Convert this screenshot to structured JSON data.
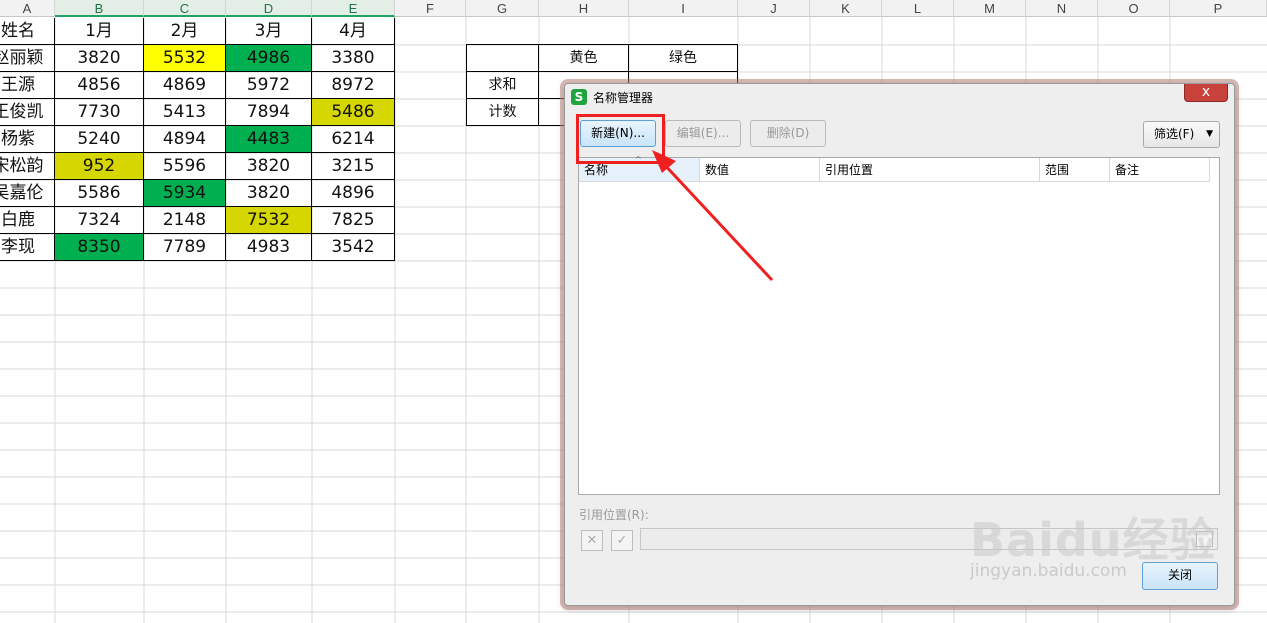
{
  "spreadsheet": {
    "columns": [
      "A",
      "B",
      "C",
      "D",
      "E",
      "F",
      "G",
      "H",
      "I",
      "J",
      "K",
      "L",
      "M",
      "N",
      "O",
      "P"
    ],
    "table_header": [
      "姓名",
      "1月",
      "2月",
      "3月",
      "4月"
    ],
    "rows": [
      {
        "name": "赵丽颖",
        "values": [
          "3820",
          "5532",
          "4986",
          "3380"
        ]
      },
      {
        "name": "王源",
        "values": [
          "4856",
          "4869",
          "5972",
          "8972"
        ]
      },
      {
        "name": "王俊凯",
        "values": [
          "7730",
          "5413",
          "7894",
          "5486"
        ]
      },
      {
        "name": "杨紫",
        "values": [
          "5240",
          "4894",
          "4483",
          "6214"
        ]
      },
      {
        "name": "宋松韵",
        "values": [
          "952",
          "5596",
          "3820",
          "3215"
        ]
      },
      {
        "name": "吴嘉伦",
        "values": [
          "5586",
          "5934",
          "3820",
          "4896"
        ]
      },
      {
        "name": "白鹿",
        "values": [
          "7324",
          "2148",
          "7532",
          "7825"
        ]
      },
      {
        "name": "李现",
        "values": [
          "8350",
          "7789",
          "4983",
          "3542"
        ]
      }
    ],
    "summary": {
      "col_yellow": "黄色",
      "col_green": "绿色",
      "row_sum": "求和",
      "row_count": "计数"
    },
    "colors": {
      "yellow": "#ffff00",
      "olive_yellow": "#d6d600",
      "green": "#00b050"
    }
  },
  "dialog": {
    "title": "名称管理器",
    "icon": "wps-s-logo-icon",
    "close_symbol": "x",
    "new_button": "新建(N)...",
    "edit_button": "编辑(E)...",
    "delete_button": "删除(D)",
    "filter_button": "筛选(F)",
    "list_columns": [
      "名称",
      "数值",
      "引用位置",
      "范围",
      "备注"
    ],
    "refers_to_label": "引用位置(R):",
    "cancel_symbol": "✕",
    "confirm_symbol": "✓",
    "close_button": "关闭"
  },
  "watermark": {
    "brand": "Baidu经验",
    "url": "jingyan.baidu.com"
  },
  "annotation": {
    "arrow_color": "#f02020"
  }
}
